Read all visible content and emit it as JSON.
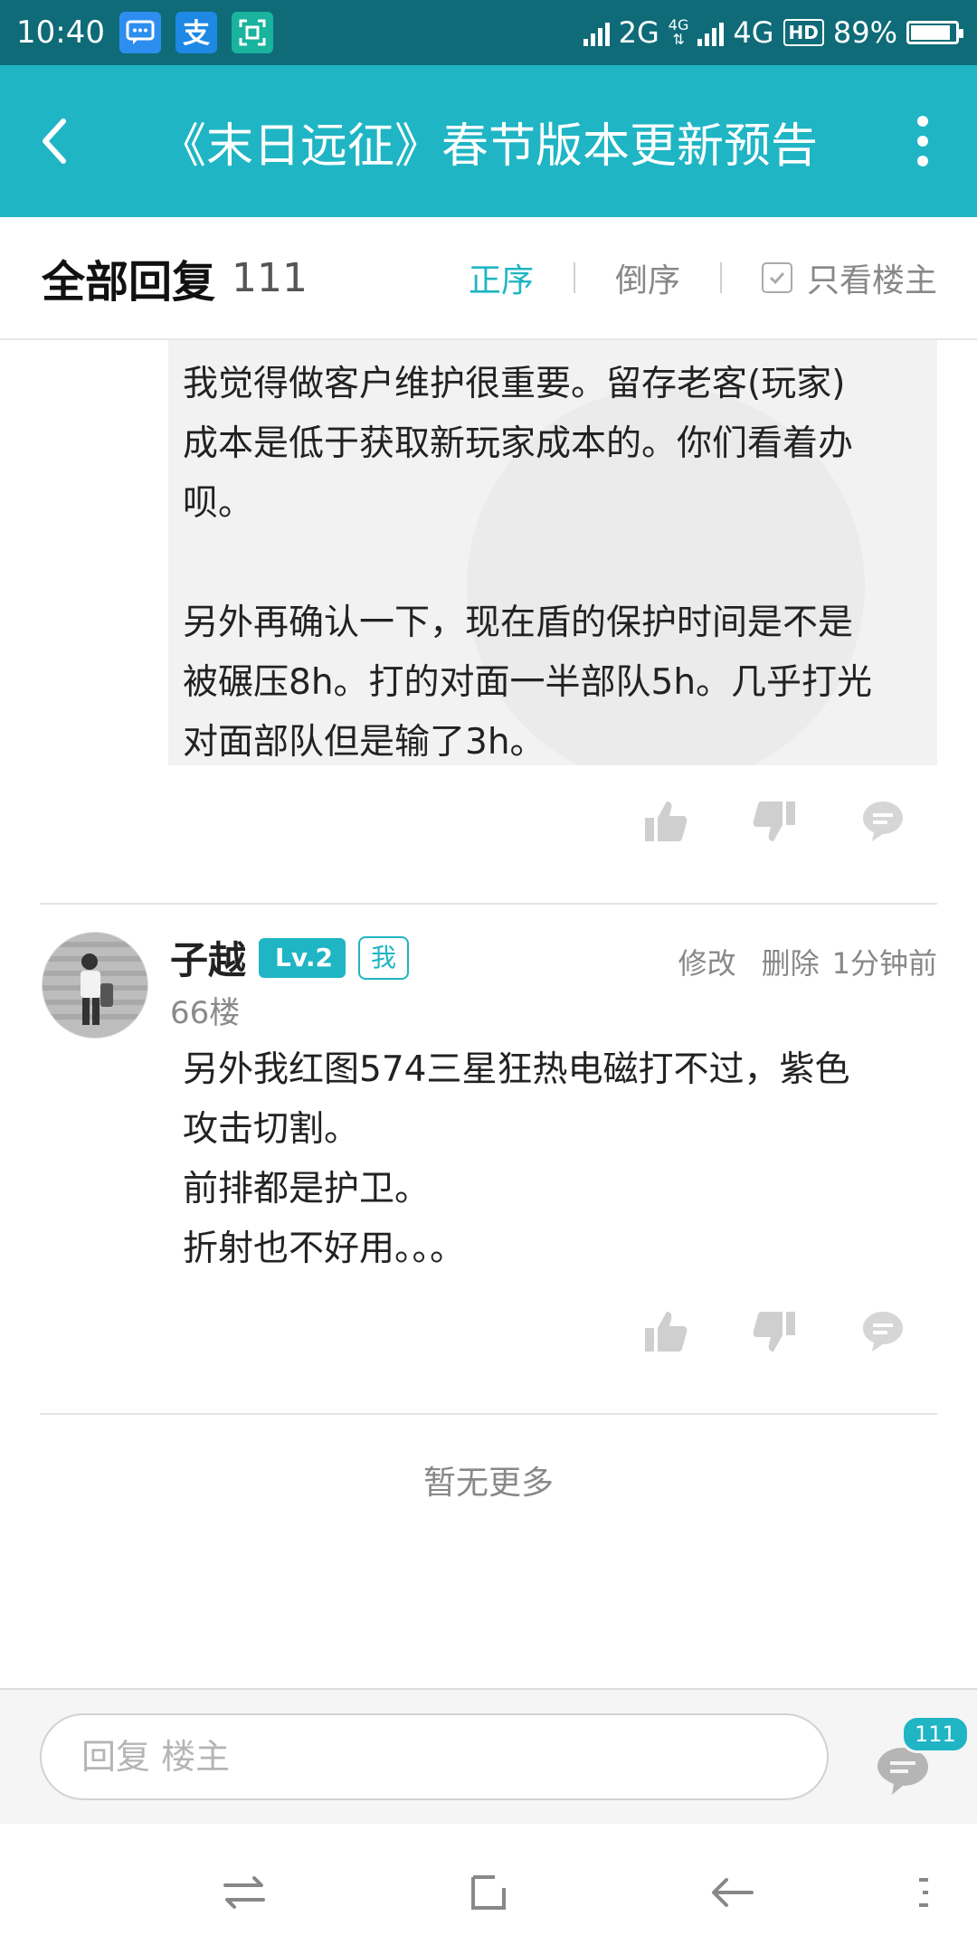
{
  "status_bar": {
    "time": "10:40",
    "net1": "2G",
    "net2": "4G",
    "net_small": "4G",
    "hd": "HD",
    "battery": "89%",
    "battery_level": 0.89,
    "apps": [
      "message-icon",
      "alipay-icon",
      "scan-icon"
    ]
  },
  "header": {
    "title": "《末日远征》春节版本更新预告"
  },
  "replies": {
    "title": "全部回复",
    "count": "111",
    "sort_asc": "正序",
    "sort_desc": "倒序",
    "only_op": "只看楼主"
  },
  "quote": {
    "text": "我觉得做客户维护很重要。留存老客(玩家)\n成本是低于获取新玩家成本的。你们看着办\n呗。\n\n另外再确认一下，现在盾的保护时间是不是\n被碾压8h。打的对面一半部队5h。几乎打光\n对面部队但是输了3h。"
  },
  "reply": {
    "author": "子越",
    "level": "Lv.2",
    "me_badge": "我",
    "floor": "66楼",
    "edit": "修改",
    "delete": "删除",
    "time": "1分钟前",
    "text": "另外我红图574三星狂热电磁打不过，紫色\n攻击切割。\n前排都是护卫。\n折射也不好用。。。"
  },
  "footer": {
    "no_more": "暂无更多",
    "input_placeholder": "回复  楼主",
    "comment_count": "111"
  },
  "colors": {
    "accent": "#1fb5c4",
    "status_bar": "#0f6b78"
  }
}
